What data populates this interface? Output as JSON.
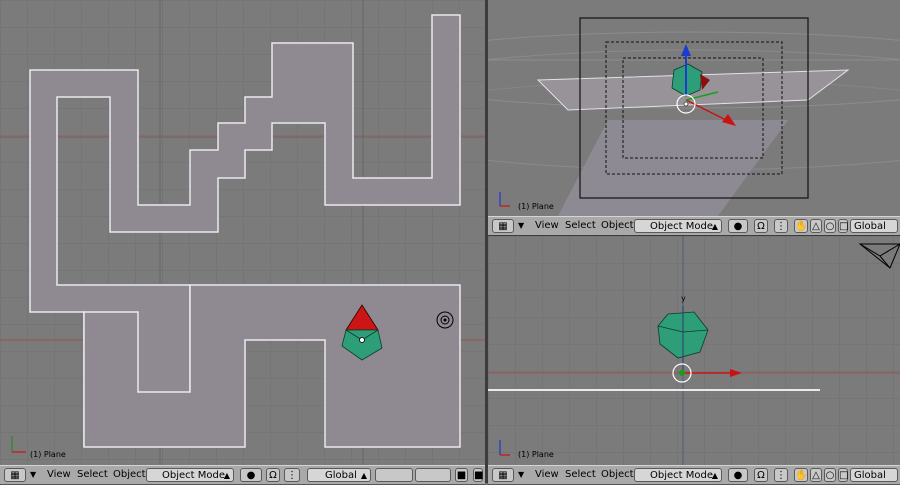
{
  "left_view": {
    "object_label": "(1) Plane",
    "header": {
      "view": "View",
      "select": "Select",
      "object": "Object",
      "mode": "Object Mode",
      "orientation": "Global"
    }
  },
  "top_right_view": {
    "object_label": "(1) Plane",
    "header": {
      "view": "View",
      "select": "Select",
      "object": "Object",
      "mode": "Object Mode",
      "orientation": "Global"
    }
  },
  "bottom_right_view": {
    "object_label": "(1) Plane",
    "axis_label": "y",
    "header": {
      "view": "View",
      "select": "Select",
      "object": "Object",
      "mode": "Object Mode",
      "orientation": "Global"
    }
  },
  "colors": {
    "viewport_bg": "#7b7b7b",
    "plane": "#8f8a92",
    "outline": "#e8e4ec",
    "mesh_green": "#2e9e78",
    "axis_red": "#cc1111",
    "axis_blue": "#1d3ccc",
    "header": "#a9a9a9"
  }
}
